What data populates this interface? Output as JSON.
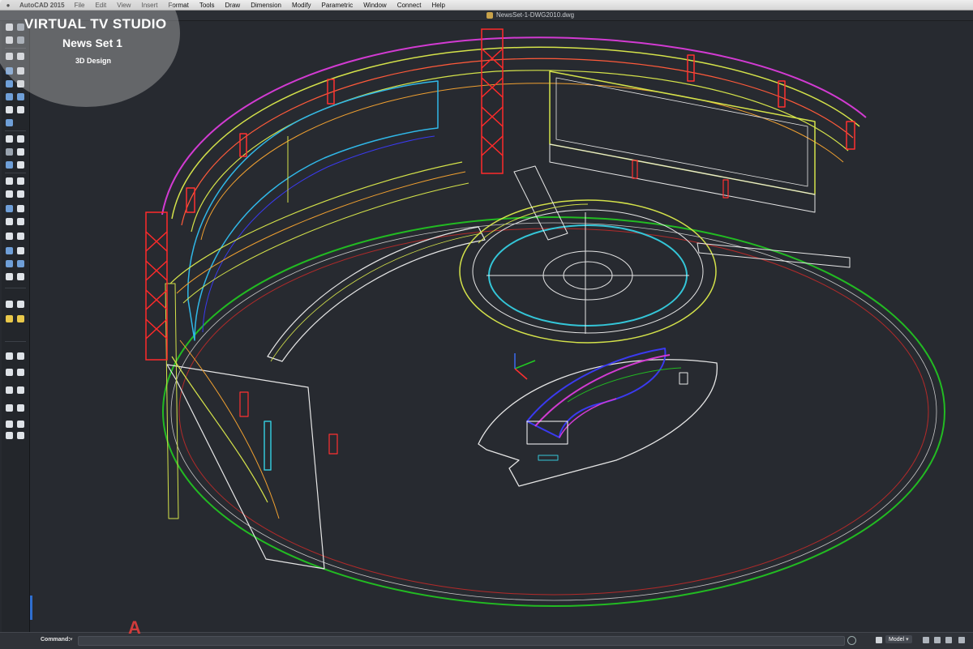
{
  "menubar": {
    "app_name": "AutoCAD 2015",
    "items": [
      "File",
      "Edit",
      "View",
      "Insert",
      "Format",
      "Tools",
      "Draw",
      "Dimension",
      "Modify",
      "Parametric",
      "Window",
      "Connect",
      "Help"
    ]
  },
  "document": {
    "title": "NewsSet-1-DWG2010.dwg"
  },
  "watermark": {
    "line1": "VIRTUAL TV STUDIO",
    "line2": "News Set 1",
    "line3": "3D Design"
  },
  "command_line": {
    "label": "Command:",
    "value": ""
  },
  "status_bar": {
    "model_tab": "Model"
  },
  "colors": {
    "background": "#272a30",
    "truss": "#ff2a2a",
    "floor_ring": "#22bb22",
    "wall_yellow": "#d4e24a",
    "magenta": "#d23bd2",
    "cyan": "#34c6d8",
    "desk_blue": "#3a3af0"
  },
  "icons": [
    "apple-icon",
    "document-icon",
    "autocad-logo-icon",
    "layout-icon",
    "settings-icon"
  ]
}
